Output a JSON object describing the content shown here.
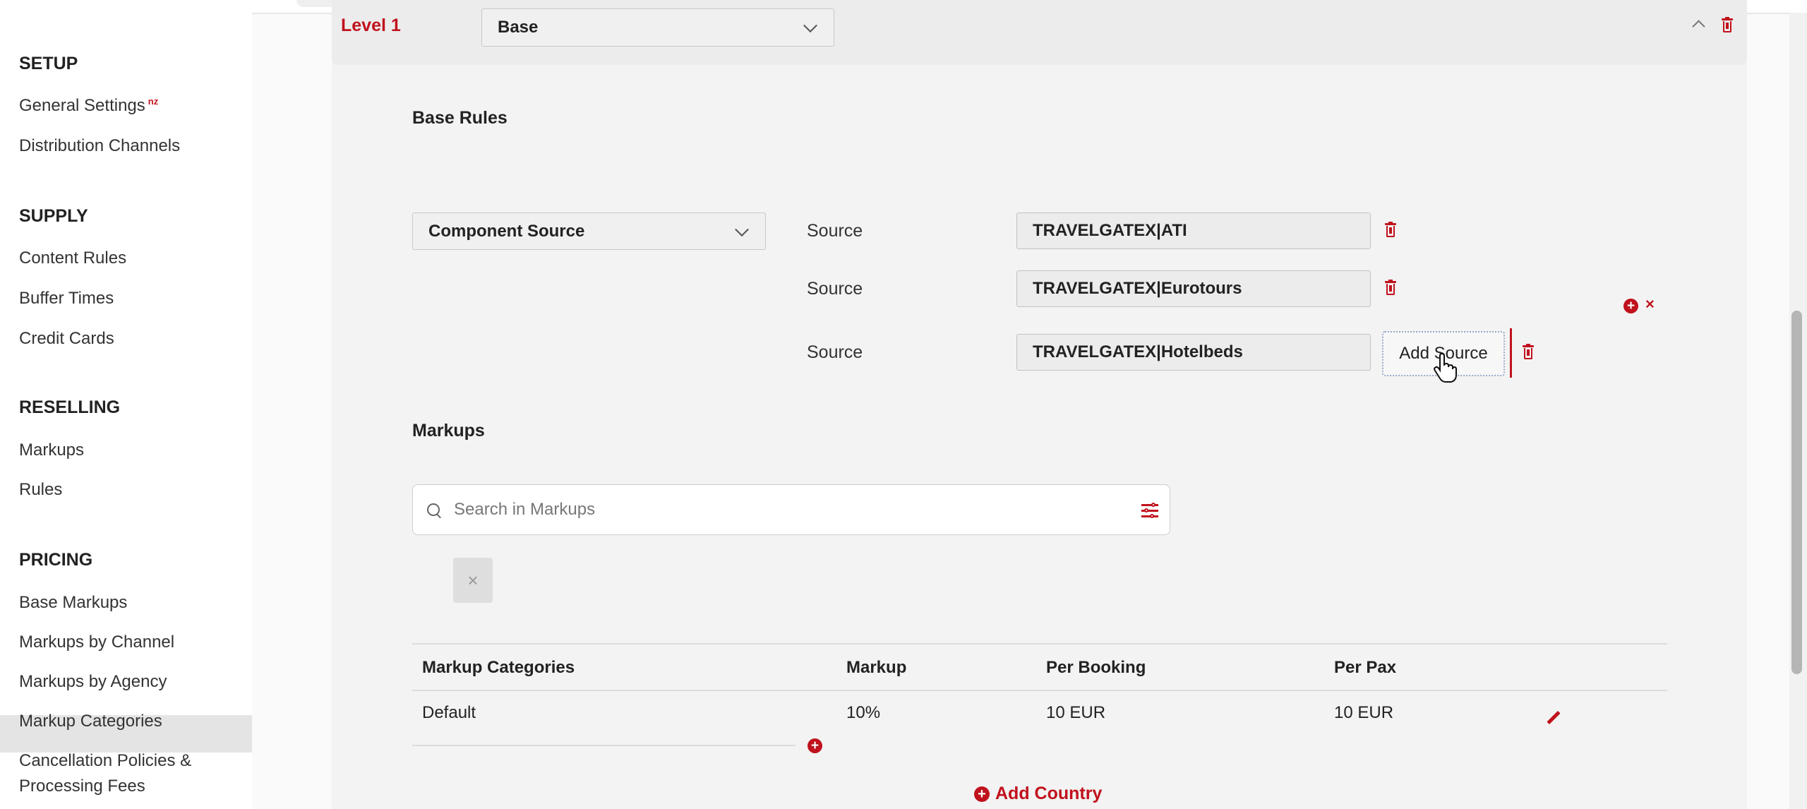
{
  "sidebar": {
    "sections": [
      {
        "title": "SETUP",
        "items": [
          {
            "label": "General Settings",
            "badge": "nz"
          },
          {
            "label": "Distribution Channels"
          }
        ]
      },
      {
        "title": "SUPPLY",
        "items": [
          {
            "label": "Content Rules"
          },
          {
            "label": "Buffer Times"
          },
          {
            "label": "Credit Cards"
          }
        ]
      },
      {
        "title": "RESELLING",
        "items": [
          {
            "label": "Markups"
          },
          {
            "label": "Rules"
          }
        ]
      },
      {
        "title": "PRICING",
        "items": [
          {
            "label": "Base Markups"
          },
          {
            "label": "Markups by Channel"
          },
          {
            "label": "Markups by Agency"
          },
          {
            "label": "Markup Categories"
          },
          {
            "label": "Cancellation Policies &"
          },
          {
            "label": "Processing Fees"
          }
        ]
      }
    ],
    "active_item": "Markup Categories"
  },
  "level": {
    "label": "Level 1",
    "select_value": "Base"
  },
  "base_rules": {
    "heading": "Base Rules",
    "rule_type": "Component Source",
    "source_label": "Source",
    "sources": [
      "TRAVELGATEX|ATI",
      "TRAVELGATEX|Eurotours",
      "TRAVELGATEX|Hotelbeds"
    ],
    "add_source_label": "Add Source"
  },
  "markups": {
    "heading": "Markups",
    "search_placeholder": "Search in Markups",
    "clear_label": "×",
    "table": {
      "headers": [
        "Markup Categories",
        "Markup",
        "Per Booking",
        "Per Pax"
      ],
      "rows": [
        {
          "category": "Default",
          "markup": "10%",
          "per_booking": "10 EUR",
          "per_pax": "10 EUR"
        }
      ]
    },
    "add_country_label": "Add Country"
  },
  "colors": {
    "accent": "#c0121d",
    "active_bg": "#e4e4e4"
  }
}
